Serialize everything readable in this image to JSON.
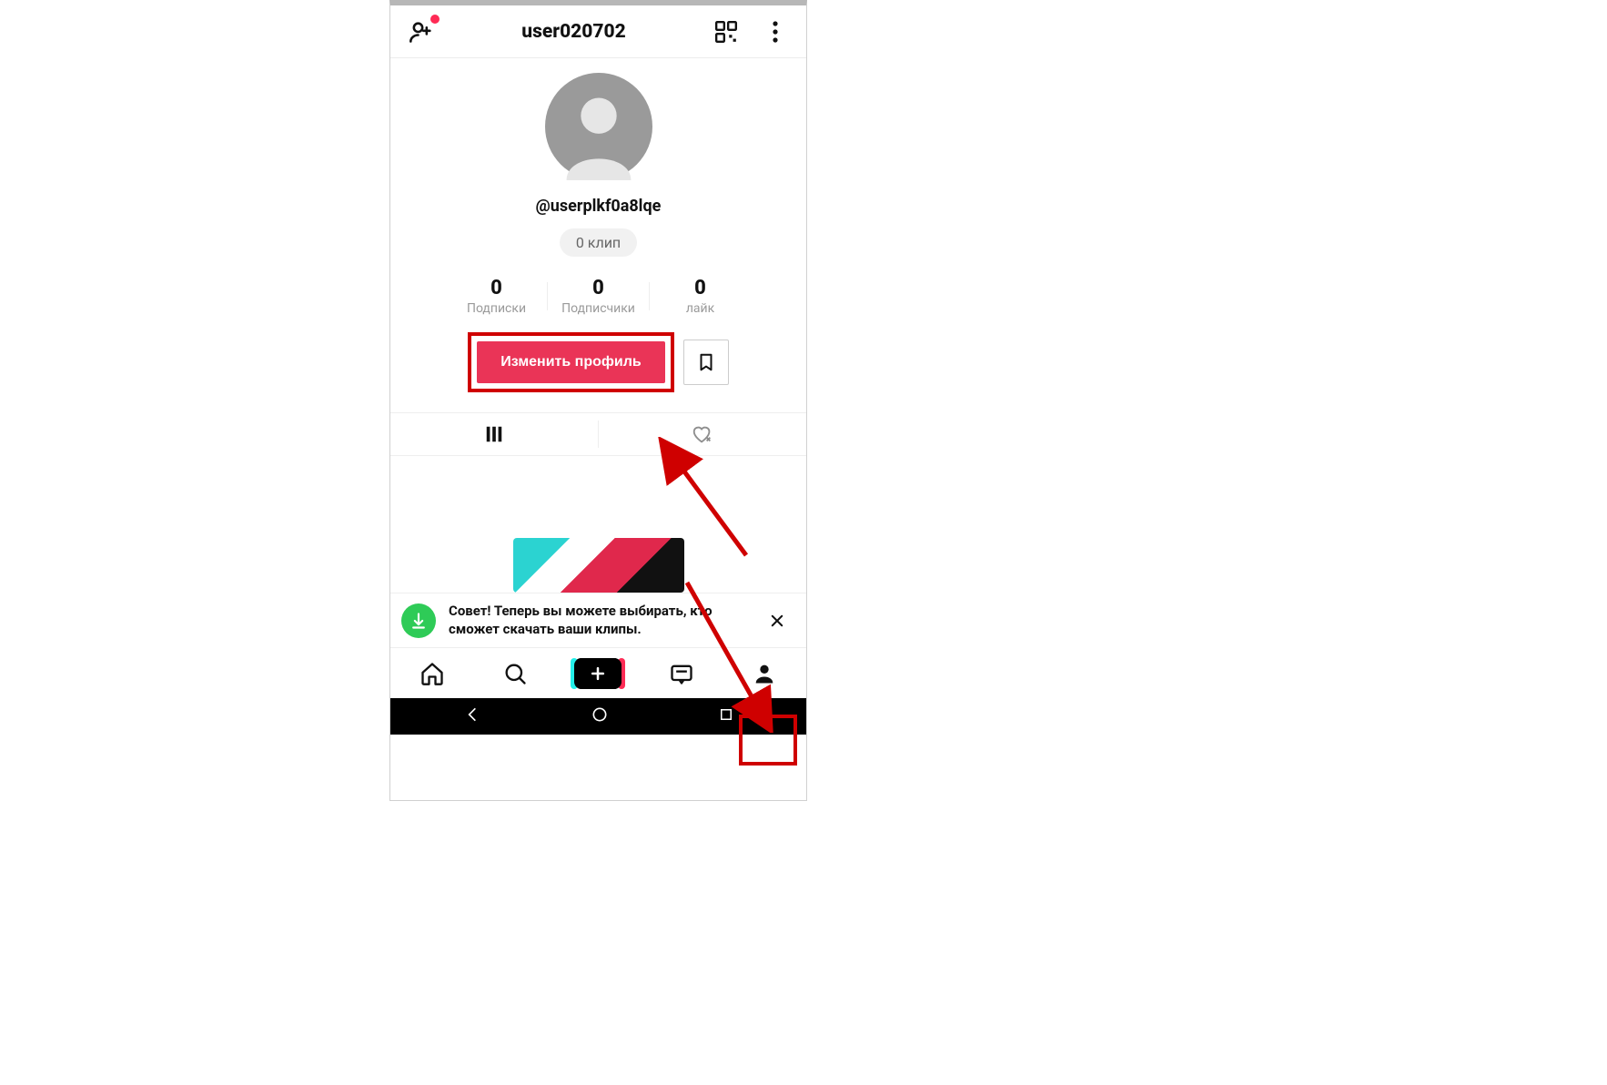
{
  "header": {
    "title": "user020702"
  },
  "profile": {
    "handle": "@userplkf0a8lqe",
    "clips_pill": "0 клип",
    "stats": {
      "following": {
        "count": "0",
        "label": "Подписки"
      },
      "followers": {
        "count": "0",
        "label": "Подписчики"
      },
      "likes": {
        "count": "0",
        "label": "лайк"
      }
    },
    "edit_button_label": "Изменить профиль"
  },
  "tip": {
    "text": "Совет! Теперь вы можете выбирать, кто сможет скачать ваши клипы."
  },
  "icons": {
    "add_friend": "add-friend-icon",
    "qr": "qr-icon",
    "more": "more-icon",
    "bookmark": "bookmark-icon",
    "grid_tab": "grid-tab-icon",
    "liked_tab": "liked-tab-icon",
    "download": "download-icon",
    "close": "close-icon",
    "home": "home-icon",
    "search": "search-icon",
    "create": "create-icon",
    "inbox": "inbox-icon",
    "profile": "profile-icon",
    "back": "back-icon",
    "sys_home": "sys-home-icon",
    "recents": "recents-icon"
  },
  "colors": {
    "accent": "#ea3457",
    "highlight": "#cf0000",
    "tip_icon": "#2ecb57"
  }
}
